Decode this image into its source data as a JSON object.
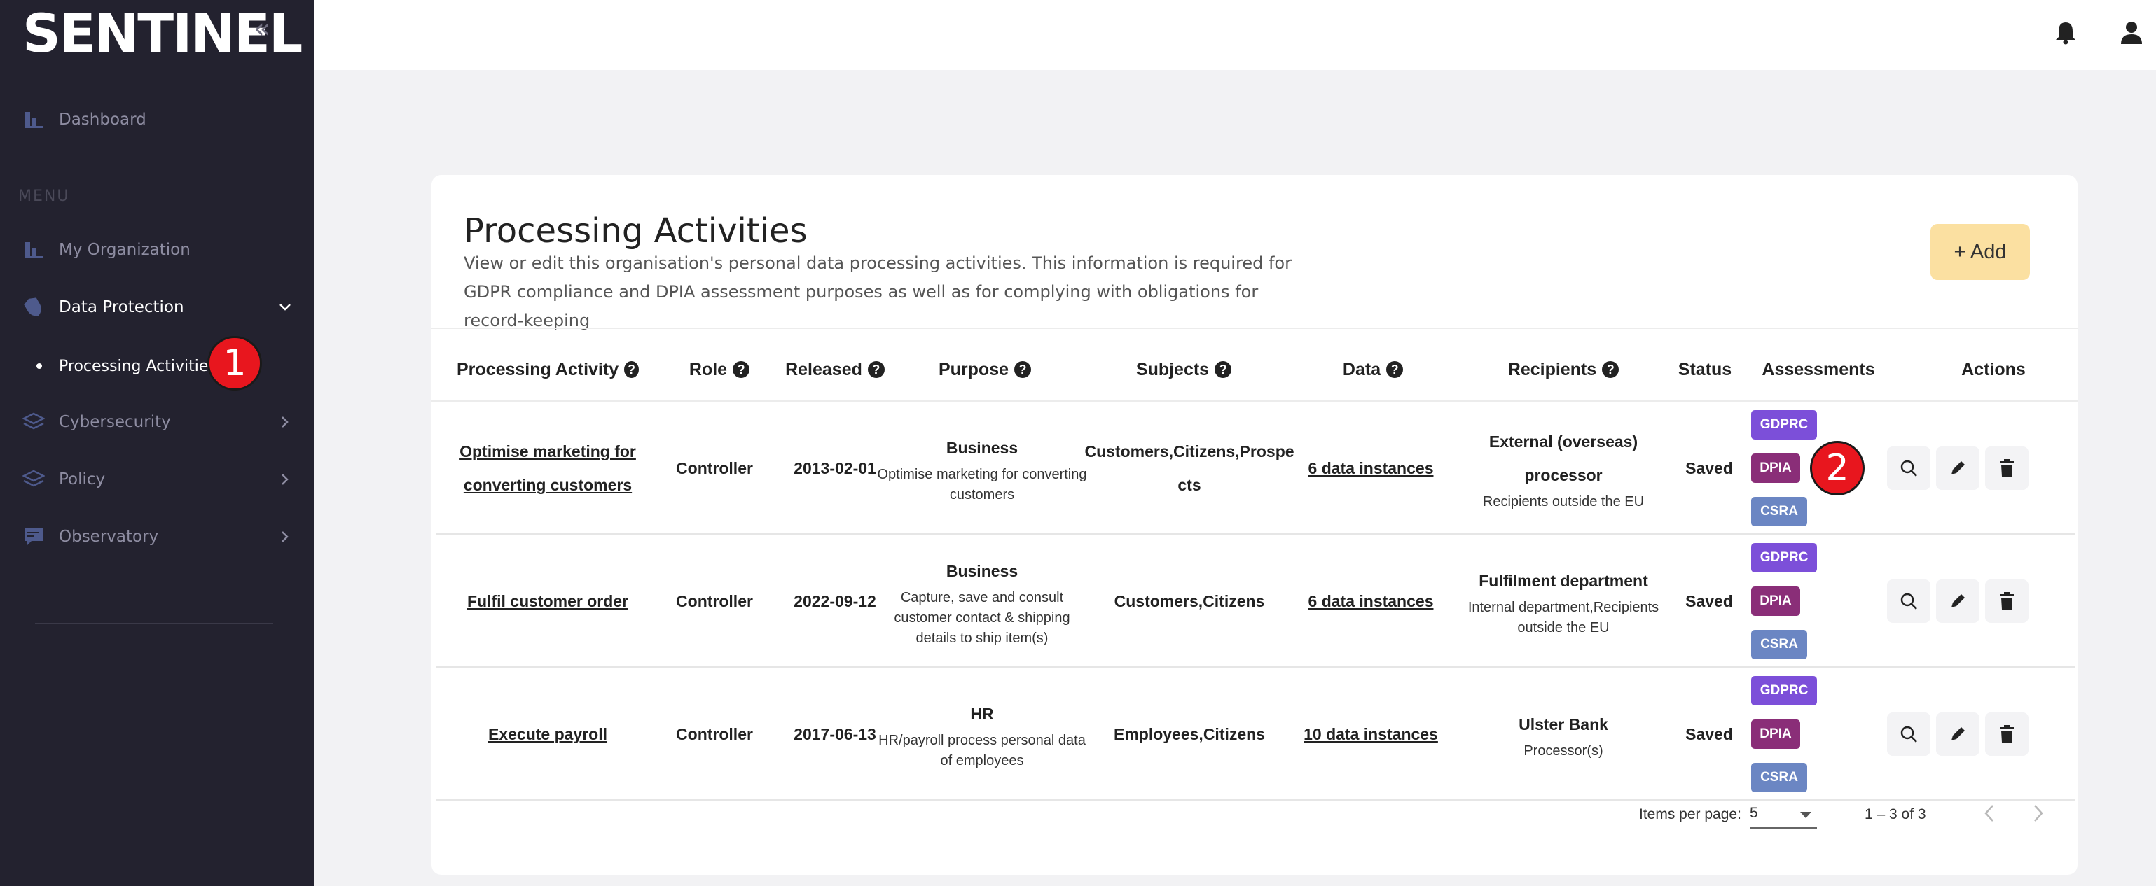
{
  "app": {
    "logo": "SENTINEL",
    "collapse_glyph": "«"
  },
  "sidebar": {
    "dashboard": "Dashboard",
    "menu_label": "MENU",
    "items": [
      {
        "label": "My Organization",
        "icon": "chart-icon"
      },
      {
        "label": "Data Protection",
        "icon": "shield-icon",
        "active": true
      },
      {
        "label": "Cybersecurity",
        "icon": "layers-icon"
      },
      {
        "label": "Policy",
        "icon": "layers-icon"
      },
      {
        "label": "Observatory",
        "icon": "message-icon"
      }
    ],
    "subitem": "Processing Activities"
  },
  "markers": {
    "one": "1",
    "two": "2"
  },
  "page": {
    "title": "Processing Activities",
    "description": "View or edit this organisation's personal data processing activities. This information is required for GDPR compliance and DPIA assessment purposes as well as for complying with obligations for record-keeping",
    "add_button": "+ Add"
  },
  "table": {
    "headers": {
      "activity": "Processing Activity",
      "role": "Role",
      "released": "Released",
      "purpose": "Purpose",
      "subjects": "Subjects",
      "data": "Data",
      "recipients": "Recipients",
      "status": "Status",
      "assessments": "Assessments",
      "actions": "Actions"
    },
    "rows": [
      {
        "activity_l1": "Optimise marketing for",
        "activity_l2": "converting customers",
        "role": "Controller",
        "released": "2013-02-01",
        "purpose_title": "Business",
        "purpose_l1": "Optimise marketing for converting",
        "purpose_l2": "customers",
        "subjects_l1": "Customers,Citizens,Prospe",
        "subjects_l2": "cts",
        "data": "6 data instances",
        "recipients_l1": "External (overseas)",
        "recipients_l2": "processor",
        "recipients_note": "Recipients outside the EU",
        "status": "Saved",
        "assessments": [
          "GDPRC",
          "DPIA",
          "CSRA"
        ]
      },
      {
        "activity_l1": "Fulfil customer order",
        "role": "Controller",
        "released": "2022-09-12",
        "purpose_title": "Business",
        "purpose_l1": "Capture, save and consult",
        "purpose_l2": "customer contact & shipping",
        "purpose_l3": "details to ship item(s)",
        "subjects_l1": "Customers,Citizens",
        "data": "6 data instances",
        "recipients_l1": "Fulfilment department",
        "recipients_note": "Internal department,Recipients",
        "recipients_note2": "outside the EU",
        "status": "Saved",
        "assessments": [
          "GDPRC",
          "DPIA",
          "CSRA"
        ]
      },
      {
        "activity_l1": "Execute payroll",
        "role": "Controller",
        "released": "2017-06-13",
        "purpose_title": "HR",
        "purpose_l1": "HR/payroll process personal data",
        "purpose_l2": "of employees",
        "subjects_l1": "Employees,Citizens",
        "data": "10 data instances",
        "recipients_l1": "Ulster Bank",
        "recipients_note": "Processor(s)",
        "status": "Saved",
        "assessments": [
          "GDPRC",
          "DPIA",
          "CSRA"
        ]
      }
    ]
  },
  "pagination": {
    "items_per_page_label": "Items per page:",
    "items_per_page_value": "5",
    "range": "1 – 3 of 3"
  },
  "colors": {
    "sidebar_bg": "#23222f",
    "gdprc": "#7c4fd9",
    "dpia": "#8a2e78",
    "csra": "#6b86c3",
    "add_button_bg": "#fbe0a1",
    "marker": "#e8161e"
  }
}
